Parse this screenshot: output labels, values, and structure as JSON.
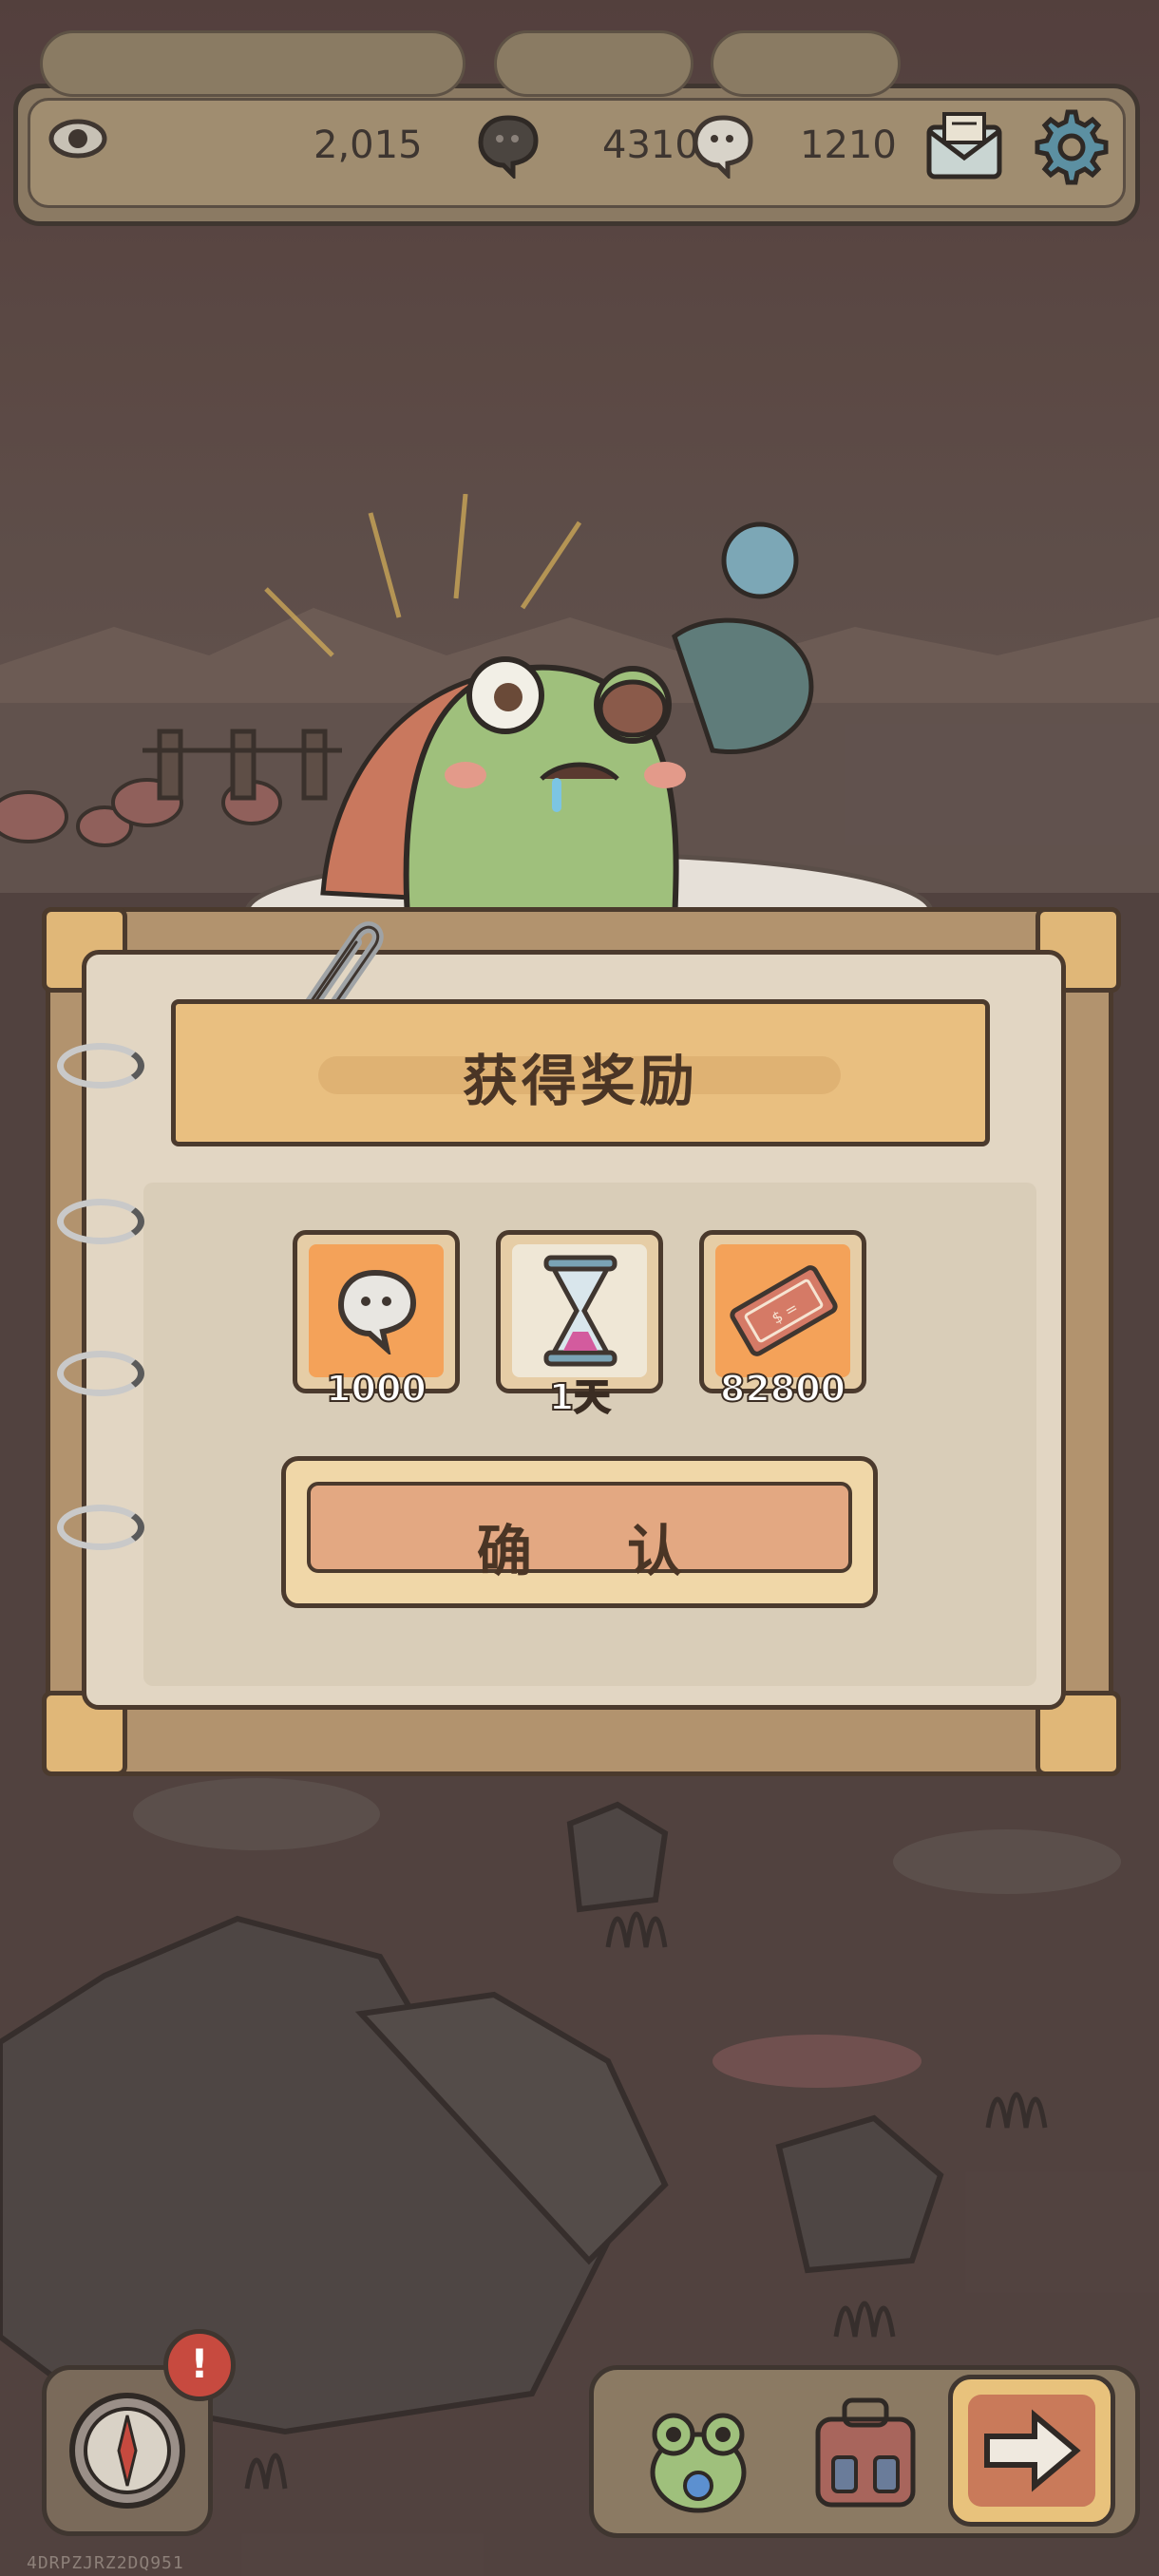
{
  "currencies": {
    "views": "2,015",
    "dark_bubbles": "4310",
    "white_bubbles": "1210"
  },
  "dialog": {
    "title": "获得奖励",
    "rewards": [
      {
        "icon": "white-bubble-icon",
        "amount": "1000"
      },
      {
        "icon": "hourglass-icon",
        "amount": "1天"
      },
      {
        "icon": "ticket-icon",
        "amount": "82800"
      }
    ],
    "confirm_label": "确 认"
  },
  "bottom": {
    "alert_badge": "!"
  },
  "watermark": "4DRPZJRZ2DQ951",
  "colors": {
    "panel": "#e2d6c3",
    "banner": "#e9bf80",
    "reward_tile": "#f4a259",
    "confirm": "#e3a882",
    "alert": "#c74a3f"
  }
}
